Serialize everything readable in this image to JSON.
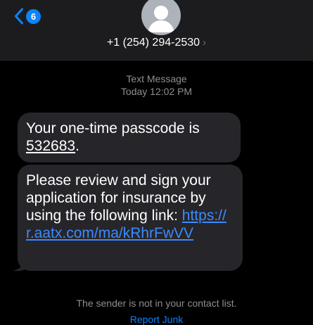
{
  "header": {
    "unread_count": "6",
    "contact_number": "+1 (254) 294-2530",
    "chevron": "›"
  },
  "thread": {
    "service": "Text Message",
    "timestamp": "Today 12:02 PM"
  },
  "messages": [
    {
      "prefix": "Your one-time passcode is ",
      "code": "532683",
      "suffix": "."
    },
    {
      "text": "Please review and sign your application for insurance by using the following link: ",
      "link": "https://r.aatx.com/ma/kRhrFwVV"
    }
  ],
  "footer": {
    "note": "The sender is not in your contact list.",
    "report_label": "Report Junk"
  },
  "colors": {
    "accent": "#0a84ff",
    "bubble": "#26252a",
    "header_bg": "#1c1c1e",
    "secondary_text": "#8e8e93"
  },
  "icons": {
    "back": "chevron-left-icon",
    "avatar": "person-avatar-icon",
    "contact_details": "chevron-right-icon"
  }
}
